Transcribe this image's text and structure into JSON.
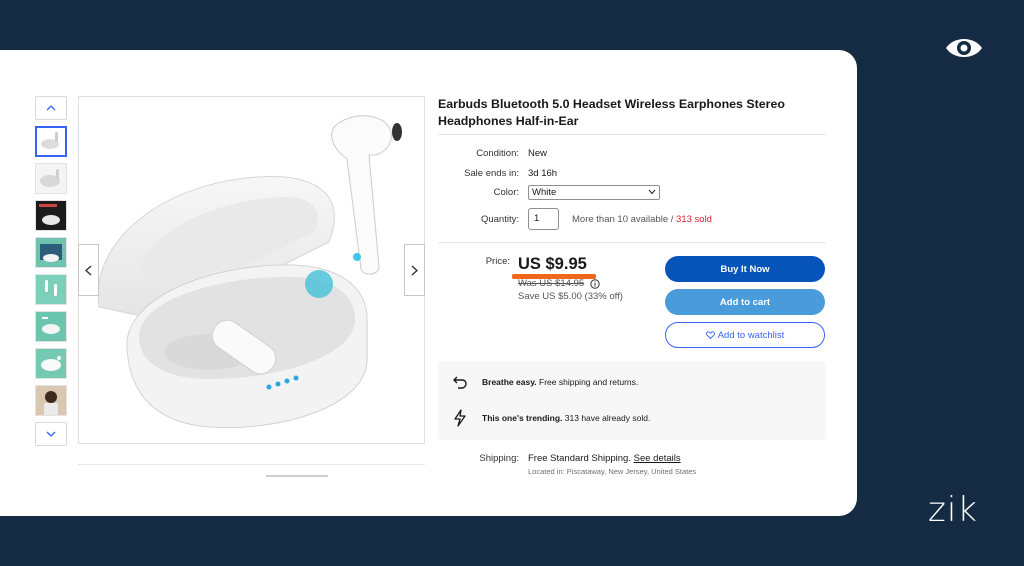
{
  "brand": {
    "logo_text": "zik",
    "eye_icon": "eye-icon"
  },
  "product": {
    "title": "Earbuds Bluetooth 5.0 Headset Wireless Earphones Stereo Headphones Half-in-Ear",
    "thumbnail_count": 8,
    "selected_thumbnail": 1
  },
  "details": {
    "condition_label": "Condition:",
    "condition_value": "New",
    "sale_label": "Sale ends in:",
    "sale_value": "3d 16h",
    "color_label": "Color:",
    "color_value": "White",
    "quantity_label": "Quantity:",
    "quantity_value": "1",
    "availability": "More than 10 available /",
    "sold": "313 sold"
  },
  "pricing": {
    "price_label": "Price:",
    "price": "US $9.95",
    "was": "Was US $14.95",
    "save": "Save US $5.00 (33% off)"
  },
  "actions": {
    "buy_now": "Buy It Now",
    "add_to_cart": "Add to cart",
    "watchlist": "Add to watchlist"
  },
  "highlights": [
    {
      "icon": "return-arrow-icon",
      "bold": "Breathe easy.",
      "text": " Free shipping and returns."
    },
    {
      "icon": "lightning-icon",
      "bold": "This one's trending.",
      "text": " 313 have already sold."
    }
  ],
  "shipping": {
    "label": "Shipping:",
    "value": "Free Standard Shipping.",
    "link": "See details",
    "location": "Located in: Piscataway, New Jersey, United States"
  },
  "colors": {
    "background": "#152a43",
    "buy_button": "#0654ba",
    "cart_button": "#4a9bd9",
    "highlight_underline": "#f0661a",
    "sold_red": "#dd1e31"
  }
}
